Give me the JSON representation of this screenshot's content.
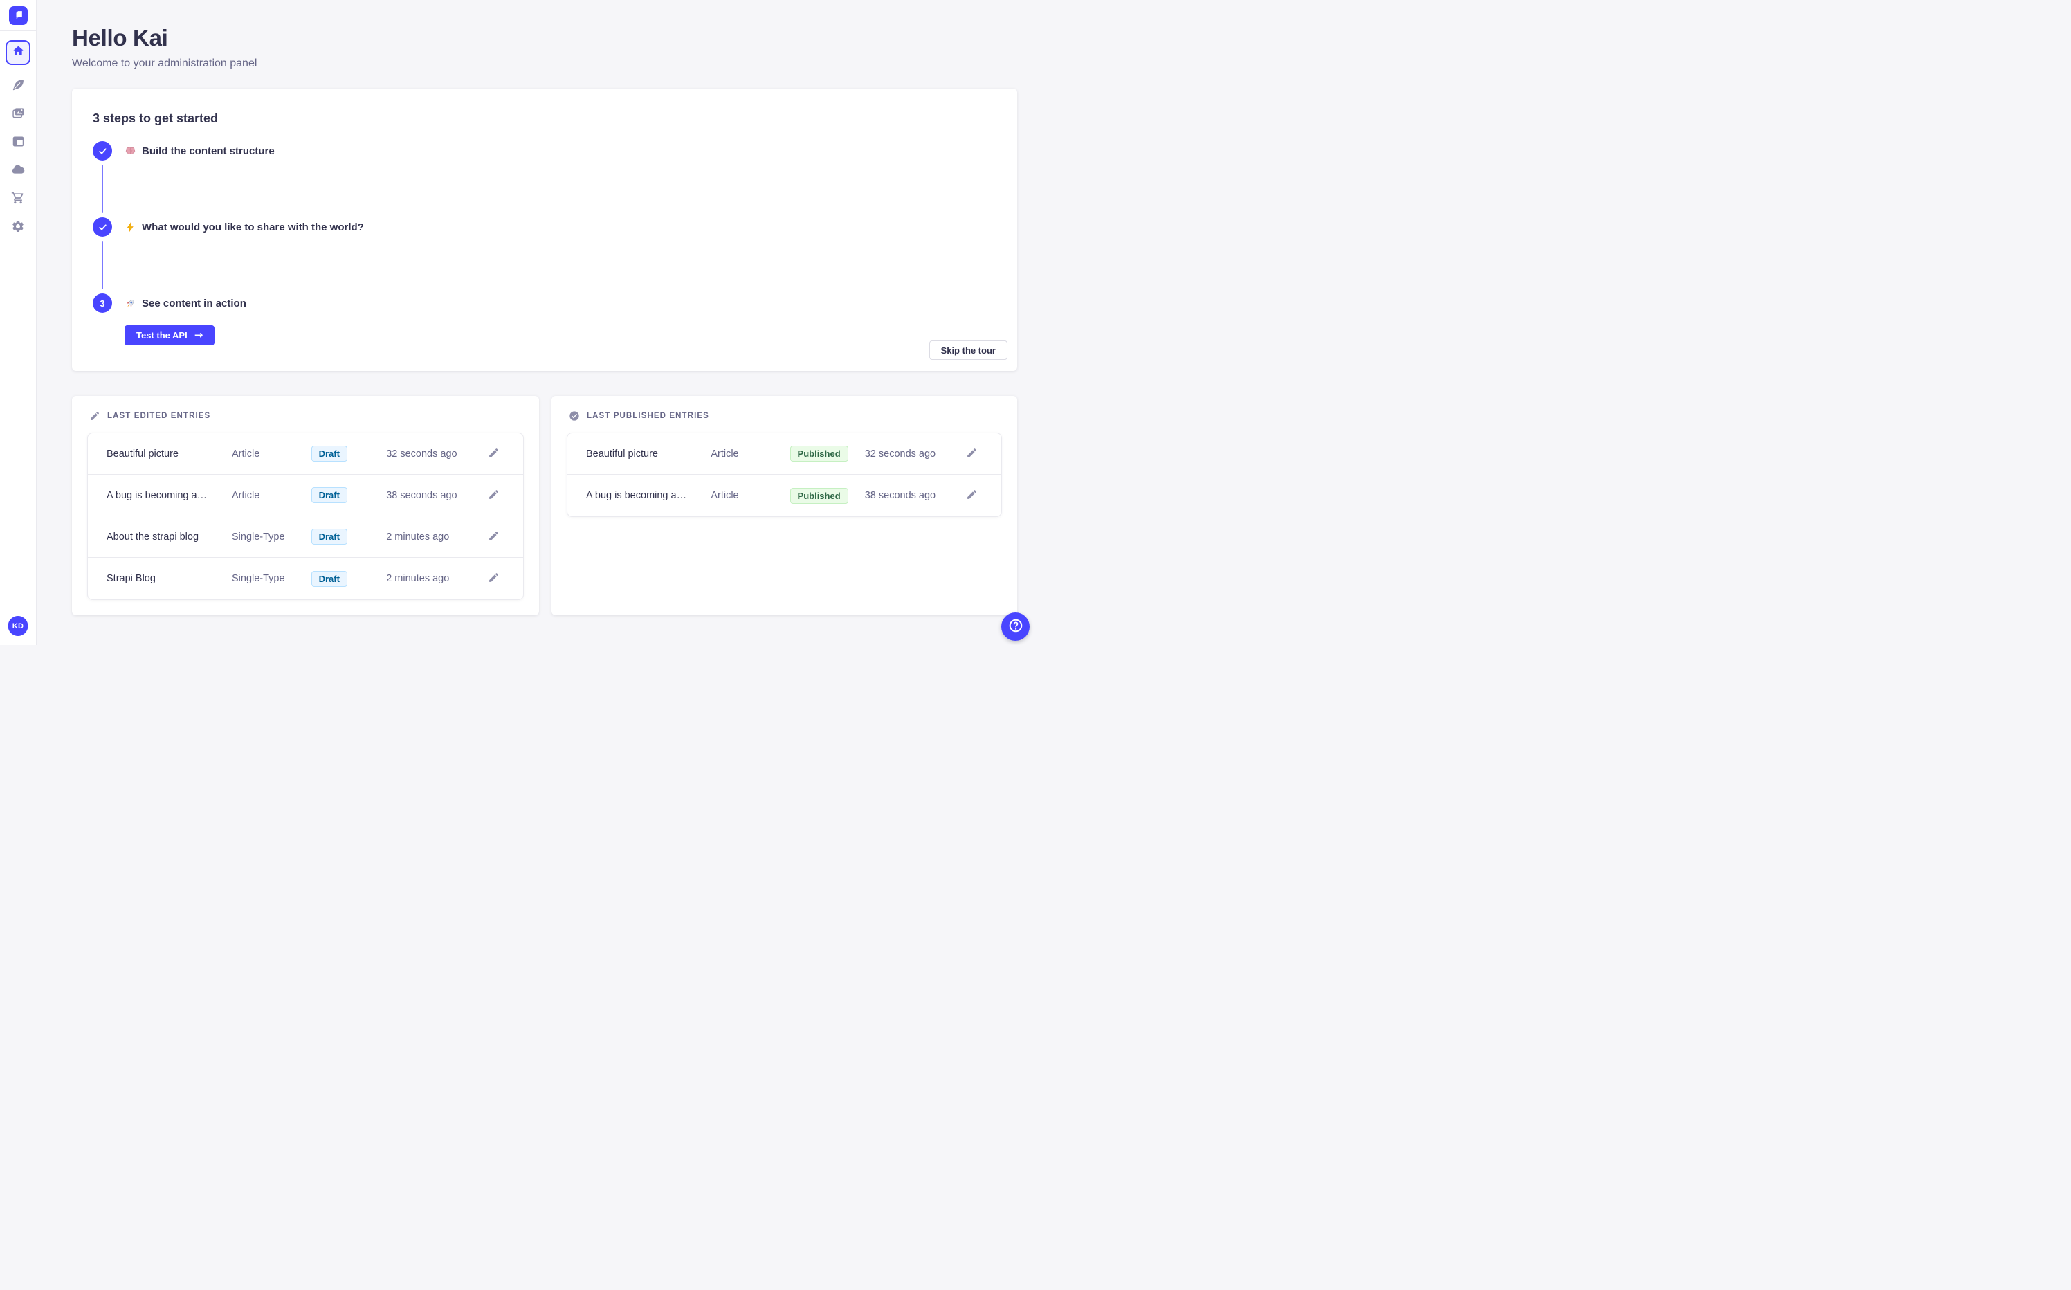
{
  "colors": {
    "accent": "#4945ff",
    "accent_light": "#7b79ff",
    "page_bg": "#f6f6f9",
    "text_dark": "#32324d",
    "text_muted": "#666687",
    "icon_gray": "#8e8ea9",
    "draft_bg": "#eaf5ff",
    "draft_border": "#b8e1ff",
    "draft_text": "#006096",
    "published_bg": "#eafbe7",
    "published_border": "#c6f0c2",
    "published_text": "#2f6846"
  },
  "sidebar": {
    "logo_icon": "strapi-logo",
    "items": [
      {
        "id": "home",
        "icon": "home-icon",
        "active": true
      },
      {
        "id": "content-manager",
        "icon": "feather-icon",
        "active": false
      },
      {
        "id": "media-library",
        "icon": "images-icon",
        "active": false
      },
      {
        "id": "content-type-builder",
        "icon": "layout-icon",
        "active": false
      },
      {
        "id": "deploy",
        "icon": "cloud-icon",
        "active": false
      },
      {
        "id": "marketplace",
        "icon": "cart-icon",
        "active": false
      },
      {
        "id": "settings",
        "icon": "gear-icon",
        "active": false
      }
    ],
    "avatar_initials": "KD"
  },
  "header": {
    "title": "Hello Kai",
    "subtitle": "Welcome to your administration panel"
  },
  "onboarding": {
    "title": "3 steps to get started",
    "steps": [
      {
        "status": "done",
        "emoji": "🧠",
        "emoji_icon": "brain-emoji",
        "label": "Build the content structure"
      },
      {
        "status": "done",
        "emoji": "⚡",
        "emoji_icon": "bolt-emoji",
        "label": "What would you like to share with the world?"
      },
      {
        "status": "current",
        "number": "3",
        "emoji": "🚀",
        "emoji_icon": "rocket-emoji",
        "label": "See content in action",
        "action_label": "Test the API",
        "action_arrow": "→"
      }
    ],
    "skip_label": "Skip the tour"
  },
  "last_edited": {
    "title": "LAST EDITED ENTRIES",
    "icon": "pencil-icon",
    "rows": [
      {
        "title": "Beautiful picture",
        "kind": "Article",
        "status": "Draft",
        "time": "32 seconds ago"
      },
      {
        "title": "A bug is becoming a…",
        "kind": "Article",
        "status": "Draft",
        "time": "38 seconds ago"
      },
      {
        "title": "About the strapi blog",
        "kind": "Single-Type",
        "status": "Draft",
        "time": "2 minutes ago"
      },
      {
        "title": "Strapi Blog",
        "kind": "Single-Type",
        "status": "Draft",
        "time": "2 minutes ago"
      }
    ]
  },
  "last_published": {
    "title": "LAST PUBLISHED ENTRIES",
    "icon": "check-circle-icon",
    "rows": [
      {
        "title": "Beautiful picture",
        "kind": "Article",
        "status": "Published",
        "time": "32 seconds ago"
      },
      {
        "title": "A bug is becoming a…",
        "kind": "Article",
        "status": "Published",
        "time": "38 seconds ago"
      }
    ]
  },
  "help": {
    "icon": "question-mark"
  }
}
